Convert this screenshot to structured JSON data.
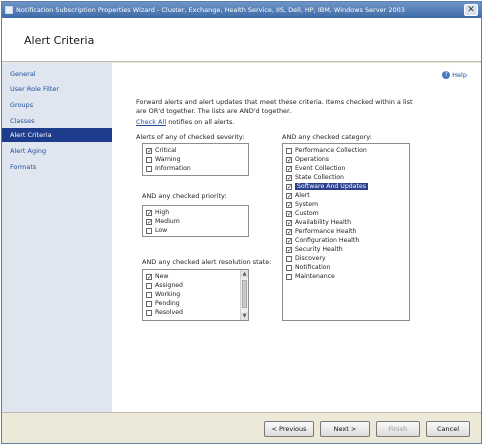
{
  "window": {
    "title": "Notification Subscription Properties Wizard - Cluster, Exchange, Health Service, IIS, Dell, HP, IBM, Windows Server 2003",
    "close_glyph": "✕"
  },
  "header": {
    "title": "Alert Criteria"
  },
  "sidebar": {
    "items": [
      {
        "label": "General"
      },
      {
        "label": "User Role Filter"
      },
      {
        "label": "Groups"
      },
      {
        "label": "Classes"
      },
      {
        "label": "Alert Criteria",
        "active": true
      },
      {
        "label": "Alert Aging"
      },
      {
        "label": "Formats"
      }
    ]
  },
  "help": {
    "label": "Help",
    "glyph": "?"
  },
  "intro": "Forward alerts and alert updates that meet these criteria.  Items checked within a list are OR'd together.  The lists are AND'd together.",
  "check_all": {
    "link": "Check All",
    "suffix": " notifies on all alerts."
  },
  "severity": {
    "label": "Alerts of any of checked severity:",
    "items": [
      {
        "label": "Critical",
        "checked": true
      },
      {
        "label": "Warning",
        "checked": false
      },
      {
        "label": "Information",
        "checked": false
      }
    ]
  },
  "priority": {
    "label": "AND any checked priority:",
    "items": [
      {
        "label": "High",
        "checked": true
      },
      {
        "label": "Medium",
        "checked": true
      },
      {
        "label": "Low",
        "checked": false
      }
    ]
  },
  "resolution": {
    "label": "AND any checked alert resolution state:",
    "items": [
      {
        "label": "New",
        "checked": true
      },
      {
        "label": "Assigned",
        "checked": false
      },
      {
        "label": "Working",
        "checked": false
      },
      {
        "label": "Pending",
        "checked": false
      },
      {
        "label": "Resolved",
        "checked": false
      }
    ]
  },
  "category": {
    "label": "AND any checked category:",
    "items": [
      {
        "label": "Performance Collection",
        "checked": false
      },
      {
        "label": "Operations",
        "checked": true
      },
      {
        "label": "Event Collection",
        "checked": true
      },
      {
        "label": "State Collection",
        "checked": true
      },
      {
        "label": "Software And Updates",
        "checked": true,
        "selected": true
      },
      {
        "label": "Alert",
        "checked": true
      },
      {
        "label": "System",
        "checked": true
      },
      {
        "label": "Custom",
        "checked": true
      },
      {
        "label": "Availability Health",
        "checked": true
      },
      {
        "label": "Performance Health",
        "checked": true
      },
      {
        "label": "Configuration Health",
        "checked": true
      },
      {
        "label": "Security Health",
        "checked": true
      },
      {
        "label": "Discovery",
        "checked": false
      },
      {
        "label": "Notification",
        "checked": false
      },
      {
        "label": "Maintenance",
        "checked": false
      }
    ]
  },
  "footer": {
    "previous": "< Previous",
    "next": "Next >",
    "finish": "Finish",
    "cancel": "Cancel"
  },
  "glyphs": {
    "check": "✓",
    "scroll_up": "▲",
    "scroll_down": "▼"
  },
  "colors": {
    "accent": "#1e3c8c",
    "link": "#1f4f9a",
    "sidebar_bg": "#dfe6f0"
  }
}
